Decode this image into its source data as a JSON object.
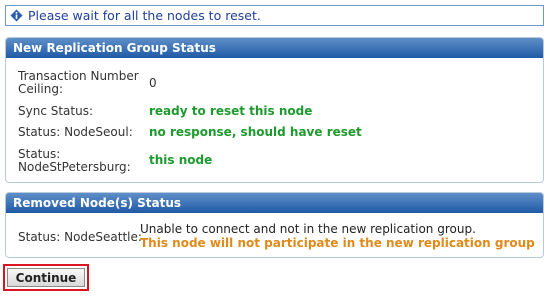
{
  "message": {
    "icon": "info-diamond-icon",
    "text": "Please wait for all the nodes to reset."
  },
  "group_status": {
    "title": "New Replication Group Status",
    "rows": [
      {
        "label": "Transaction Number Ceiling:",
        "value": "0"
      },
      {
        "label": "Sync Status:",
        "value": "ready to reset this node"
      },
      {
        "label": "Status: NodeSeoul:",
        "value": "no response, should have reset"
      },
      {
        "label": "Status: NodeStPetersburg:",
        "value": "this node"
      }
    ]
  },
  "removed_status": {
    "title": "Removed Node(s) Status",
    "label": "Status: NodeSeattle:",
    "line1": "Unable to connect and not in the new replication group.",
    "line2": "This node will not participate in the new replication group"
  },
  "continue_button": {
    "label": "Continue"
  },
  "colors": {
    "header_blue": "#1f5aa6",
    "value_green": "#1e9a2e",
    "warning_orange": "#e08a1a",
    "highlight_red": "#d9161f"
  }
}
